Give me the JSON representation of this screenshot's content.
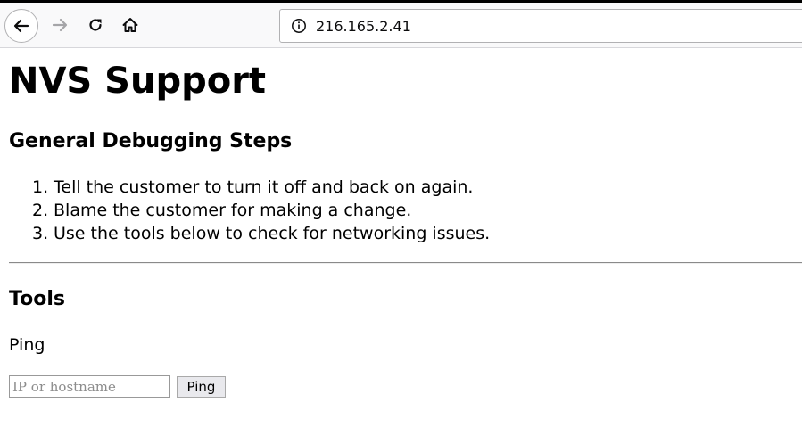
{
  "browser": {
    "url": "216.165.2.41",
    "icons": {
      "back": "arrow-left-icon",
      "forward": "arrow-right-icon",
      "reload": "reload-icon",
      "home": "home-icon",
      "info": "info-icon"
    }
  },
  "page": {
    "title": "NVS Support",
    "steps_heading": "General Debugging Steps",
    "steps": [
      {
        "num": "1.",
        "text": "Tell the customer to turn it off and back on again."
      },
      {
        "num": "2.",
        "text": "Blame the customer for making a change."
      },
      {
        "num": "3.",
        "text": "Use the tools below to check for networking issues."
      }
    ],
    "tools_heading": "Tools",
    "ping": {
      "label": "Ping",
      "placeholder": "IP or hostname",
      "value": "",
      "button_label": "Ping"
    }
  }
}
